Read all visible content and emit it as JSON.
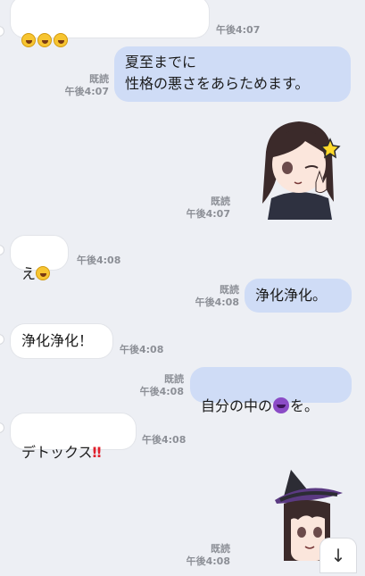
{
  "messages": [
    {
      "id": "m1",
      "time": "午後4:07",
      "content": [
        "laugh",
        "laugh",
        "laugh"
      ]
    },
    {
      "id": "m2",
      "text": "夏至までに\n性格の悪さをあらためます。",
      "read": "既読",
      "time": "午後4:07"
    },
    {
      "id": "m3",
      "sticker": "girl-wink-peace",
      "read": "既読",
      "time": "午後4:07"
    },
    {
      "id": "m4",
      "text_before": "え",
      "emoji": "laugh",
      "time": "午後4:08"
    },
    {
      "id": "m5",
      "text": "浄化浄化。",
      "read": "既読",
      "time": "午後4:08"
    },
    {
      "id": "m6",
      "text": "浄化浄化！",
      "time": "午後4:08"
    },
    {
      "id": "m7",
      "text_before": "自分の中の",
      "emoji": "devil",
      "text_after": "を。",
      "read": "既読",
      "time": "午後4:08"
    },
    {
      "id": "m8",
      "text_before": "デトックス",
      "emoji": "double-exclamation",
      "emoji_text": "‼",
      "time": "午後4:08"
    },
    {
      "id": "m9",
      "sticker": "girl-witch-hat",
      "read": "既読",
      "time": "午後4:08"
    }
  ],
  "scroll_button": {
    "icon": "arrow-down-icon",
    "glyph": "↓"
  },
  "colors": {
    "background": "#edeff4",
    "incoming": "#ffffff",
    "outgoing": "#cfdcf6",
    "meta": "#8c8f96"
  }
}
